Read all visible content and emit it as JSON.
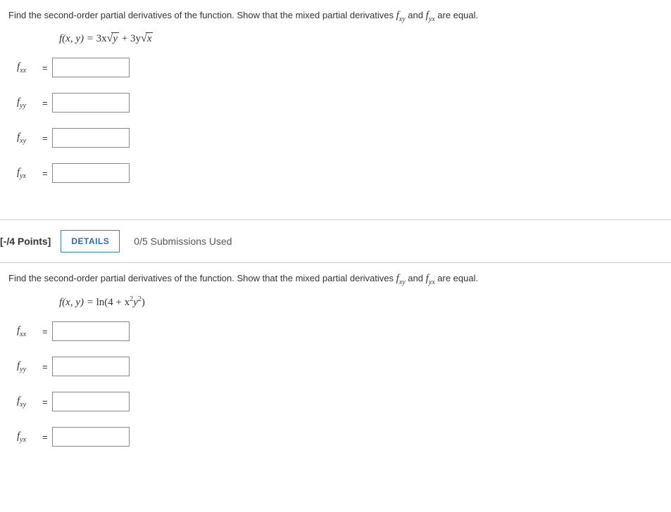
{
  "q1": {
    "prompt_pre": "Find the second-order partial derivatives of the function. Show that the mixed partial derivatives ",
    "fxy": "f",
    "fxy_sub": "xy",
    "prompt_mid": " and ",
    "fyx": "f",
    "fyx_sub": "yx",
    "prompt_post": " are equal.",
    "func_lhs": "f(x, y) = ",
    "func_rhs_a": "3x",
    "func_rad1": "y",
    "func_rhs_b": " + 3y",
    "func_rad2": "x",
    "labels": {
      "fxx": "f",
      "fxx_sub": "xx",
      "fyy": "f",
      "fyy_sub": "yy",
      "fxy": "f",
      "fxy_sub": "xy",
      "fyx": "f",
      "fyx_sub": "yx"
    },
    "eq": "="
  },
  "band": {
    "points": "[-/4 Points]",
    "details": "DETAILS",
    "submissions": "0/5 Submissions Used"
  },
  "q2": {
    "prompt_pre": "Find the second-order partial derivatives of the function. Show that the mixed partial derivatives ",
    "fxy": "f",
    "fxy_sub": "xy",
    "prompt_mid": " and ",
    "fyx": "f",
    "fyx_sub": "yx",
    "prompt_post": " are equal.",
    "func_lhs": "f(x, y) = ",
    "func_rhs_a": "ln(4 + x",
    "func_sup1": "2",
    "func_rhs_b": "y",
    "func_sup2": "2",
    "func_rhs_c": ")",
    "labels": {
      "fxx": "f",
      "fxx_sub": "xx",
      "fyy": "f",
      "fyy_sub": "yy",
      "fxy": "f",
      "fxy_sub": "xy",
      "fyx": "f",
      "fyx_sub": "yx"
    },
    "eq": "="
  }
}
